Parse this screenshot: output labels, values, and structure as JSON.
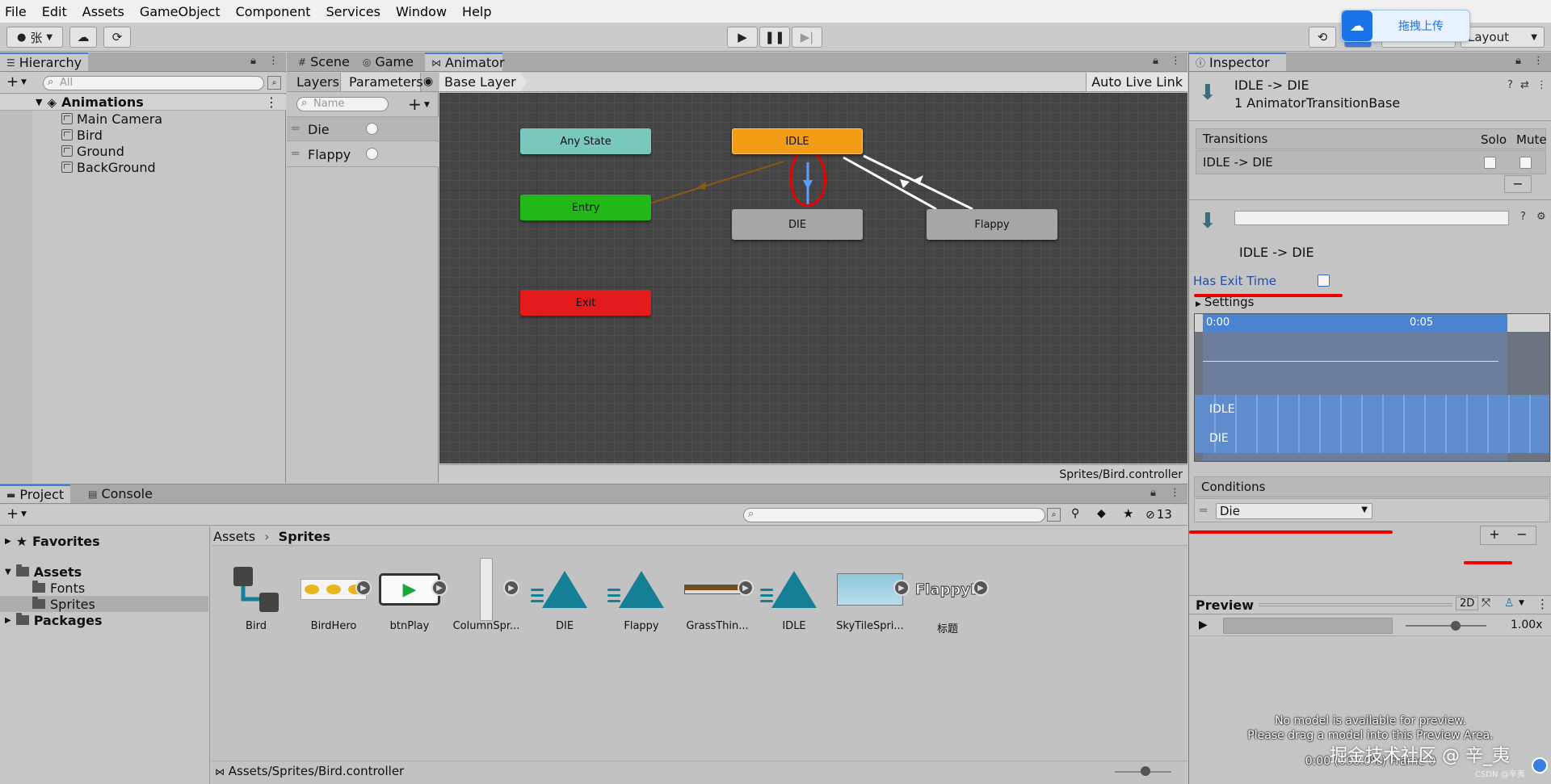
{
  "menu": [
    "File",
    "Edit",
    "Assets",
    "GameObject",
    "Component",
    "Services",
    "Window",
    "Help"
  ],
  "toolbar": {
    "account": "张",
    "layout": "Layout",
    "upload_badge": "拖拽上传"
  },
  "hierarchy": {
    "tab": "Hierarchy",
    "search_placeholder": "All",
    "scene": "Animations",
    "items": [
      "Main Camera",
      "Bird",
      "Ground",
      "BackGround"
    ]
  },
  "animator": {
    "tabs": [
      "Scene",
      "Game",
      "Animator"
    ],
    "subtabs": [
      "Layers",
      "Parameters"
    ],
    "param_search_placeholder": "Name",
    "parameters": [
      "Die",
      "Flappy"
    ],
    "breadcrumb": "Base Layer",
    "auto_live_link": "Auto Live Link",
    "states": {
      "any": "Any State",
      "idle": "IDLE",
      "entry": "Entry",
      "die": "DIE",
      "flappy": "Flappy",
      "exit": "Exit"
    },
    "footer_path": "Sprites/Bird.controller",
    "colors": {
      "any": "#79c8bd",
      "idle": "#f39c16",
      "entry": "#22b818",
      "default": "#a6a6a6",
      "exit": "#e41b1b",
      "grid": "#474747"
    }
  },
  "project": {
    "tabs": [
      "Project",
      "Console"
    ],
    "hidden_count": "13",
    "tree": {
      "favorites": "Favorites",
      "assets": "Assets",
      "fonts": "Fonts",
      "sprites": "Sprites",
      "packages": "Packages"
    },
    "breadcrumb": [
      "Assets",
      "Sprites"
    ],
    "assets": [
      "Bird",
      "BirdHero",
      "btnPlay",
      "ColumnSpr...",
      "DIE",
      "Flappy",
      "GrassThin...",
      "IDLE",
      "SkyTileSpri...",
      "标题"
    ],
    "flappy_logo_text": "FlappyBir",
    "status_path": "Assets/Sprites/Bird.controller"
  },
  "inspector": {
    "tab": "Inspector",
    "title": "IDLE -> DIE",
    "subtitle": "1 AnimatorTransitionBase",
    "transitions_header": "Transitions",
    "solo": "Solo",
    "mute": "Mute",
    "transition_row": "IDLE -> DIE",
    "transition_name": "IDLE -> DIE",
    "has_exit_time": "Has Exit Time",
    "settings": "Settings",
    "timeline_start": "0:00",
    "timeline_mid": "0:05",
    "clip_top_label": "IDLE",
    "clip_bottom_label": "DIE",
    "conditions_header": "Conditions",
    "condition_value": "Die",
    "preview_header": "Preview",
    "preview_2d": "2D",
    "speed": "1.00x",
    "preview_msg1": "No model is available for preview.",
    "preview_msg2": "Please drag a model into this Preview Area.",
    "frame_info": "0:00 (000.0%) Frame 0"
  },
  "watermark": "掘金技术社区 @ 辛_夷",
  "watermark_small": "CSDN @辛夷"
}
